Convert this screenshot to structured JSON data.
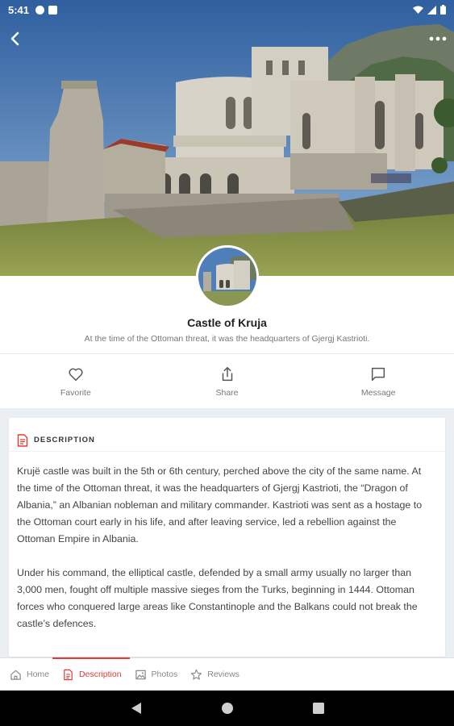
{
  "status_bar": {
    "time": "5:41",
    "icons": [
      "app-icon",
      "sim-icon",
      "wifi-icon",
      "signal-icon",
      "battery-icon"
    ]
  },
  "hero": {
    "icons": {
      "back": "back-arrow-icon",
      "more": "more-options-icon"
    }
  },
  "place": {
    "title": "Castle of Kruja",
    "subtitle": "At the time of the Ottoman threat, it was the headquarters of Gjergj Kastrioti."
  },
  "actions": [
    {
      "label": "Favorite",
      "icon": "heart-icon"
    },
    {
      "label": "Share",
      "icon": "share-icon"
    },
    {
      "label": "Message",
      "icon": "message-icon"
    }
  ],
  "description": {
    "header": "DESCRIPTION",
    "paragraphs": [
      "Krujë castle was built in the 5th or 6th century, perched above the city of the same name. At the time of the Ottoman threat, it was the headquarters of Gjergj Kastrioti, the “Dragon of Albania,” an Albanian nobleman and military commander. Kastrioti was sent as a hostage to the Ottoman court early in his life, and after leaving service, led a rebellion against the Ottoman Empire in Albania.",
      "Under his command, the elliptical castle, defended by a small army usually no larger than 3,000 men, fought off multiple massive sieges from the Turks, beginning in 1444. Ottoman forces who conquered large areas like Constantinople and the Balkans could not break the castle’s defences."
    ]
  },
  "tabs": [
    {
      "label": "Home",
      "icon": "home-icon",
      "active": false
    },
    {
      "label": "Description",
      "icon": "document-icon",
      "active": true
    },
    {
      "label": "Photos",
      "icon": "image-icon",
      "active": false
    },
    {
      "label": "Reviews",
      "icon": "star-icon",
      "active": false
    }
  ],
  "colors": {
    "accent": "#e53935",
    "sky": "#4f7fb8"
  }
}
